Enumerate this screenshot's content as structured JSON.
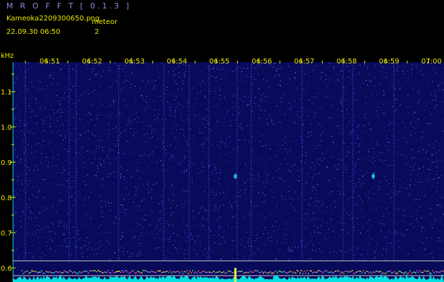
{
  "header": {
    "app_title": "M R O F F T  [ 0.1.3 ]",
    "file_name": "Kameoka2209300650.png",
    "meteor_label": "meteor",
    "datetime": "22.09.30 06:50",
    "meteor_count": "2"
  },
  "colors": {
    "background": "#000000",
    "text": "#e8e800",
    "title": "#8a8ae0",
    "spectrogram_bg": "#0a0a5a",
    "noise_floor": "#00e0e0"
  },
  "chart_data": {
    "type": "heatmap",
    "xlabel": "",
    "ylabel": "kHz",
    "x_ticks": [
      "06:51",
      "06:52",
      "06:53",
      "06:54",
      "06:55",
      "06:56",
      "06:57",
      "06:58",
      "06:59",
      "07:00"
    ],
    "y_ticks": [
      "1.1",
      "1.0",
      "0.9",
      "0.8",
      "0.7",
      "0.6"
    ],
    "y_values": [
      1.1,
      1.0,
      0.9,
      0.8,
      0.7,
      0.6
    ],
    "ylim": [
      0.58,
      1.2
    ],
    "xlim_minutes": [
      50.4,
      60
    ],
    "grid": false,
    "meteor_echoes": [
      {
        "time_minute": 55.45,
        "khz": 0.86
      },
      {
        "time_minute": 58.7,
        "khz": 0.86
      }
    ]
  }
}
